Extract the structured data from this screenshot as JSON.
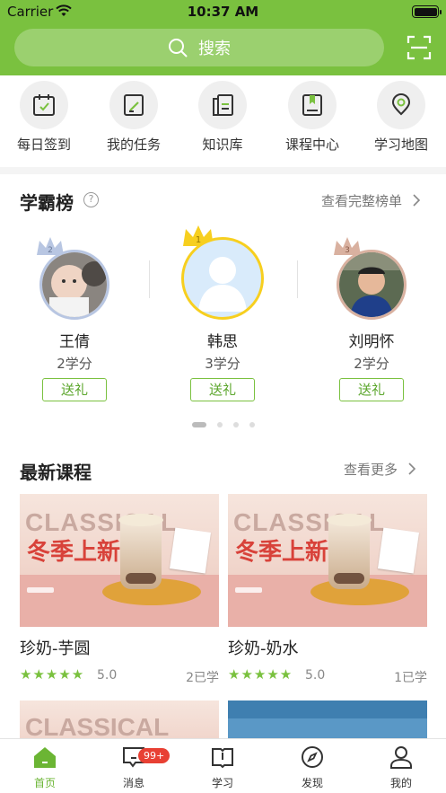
{
  "status_bar": {
    "carrier": "Carrier",
    "time": "10:37 AM"
  },
  "search": {
    "placeholder": "搜索"
  },
  "quick_nav": [
    {
      "label": "每日签到",
      "icon": "calendar-check-icon"
    },
    {
      "label": "我的任务",
      "icon": "task-edit-icon"
    },
    {
      "label": "知识库",
      "icon": "knowledge-book-icon"
    },
    {
      "label": "课程中心",
      "icon": "course-book-icon"
    },
    {
      "label": "学习地图",
      "icon": "map-pin-icon"
    }
  ],
  "ranking": {
    "title": "学霸榜",
    "help_icon": "?",
    "more": "查看完整榜单",
    "users": [
      {
        "name": "王倩",
        "score": "2学分",
        "gift": "送礼",
        "rank": "2"
      },
      {
        "name": "韩思",
        "score": "3学分",
        "gift": "送礼",
        "rank": "1"
      },
      {
        "name": "刘明怀",
        "score": "2学分",
        "gift": "送礼",
        "rank": "3"
      }
    ]
  },
  "courses": {
    "title": "最新课程",
    "more": "查看更多",
    "items": [
      {
        "name": "珍奶-芋圆",
        "stars": "★★★★★",
        "rating": "5.0",
        "learned": "2已学",
        "banner_word": "CLASSICAL",
        "banner_tag": "冬季上新"
      },
      {
        "name": "珍奶-奶水",
        "stars": "★★★★★",
        "rating": "5.0",
        "learned": "1已学",
        "banner_word": "CLASSICAL",
        "banner_tag": "冬季上新"
      }
    ],
    "next_row_banner": "CLASSICAL"
  },
  "tabbar": {
    "items": [
      {
        "label": "首页",
        "icon": "home-icon",
        "active": true
      },
      {
        "label": "消息",
        "icon": "message-icon",
        "badge": "99+"
      },
      {
        "label": "学习",
        "icon": "study-book-icon"
      },
      {
        "label": "发现",
        "icon": "compass-icon"
      },
      {
        "label": "我的",
        "icon": "profile-icon"
      }
    ]
  },
  "colors": {
    "brand": "#7ac13f",
    "badge": "#e84033",
    "text": "#222222"
  }
}
